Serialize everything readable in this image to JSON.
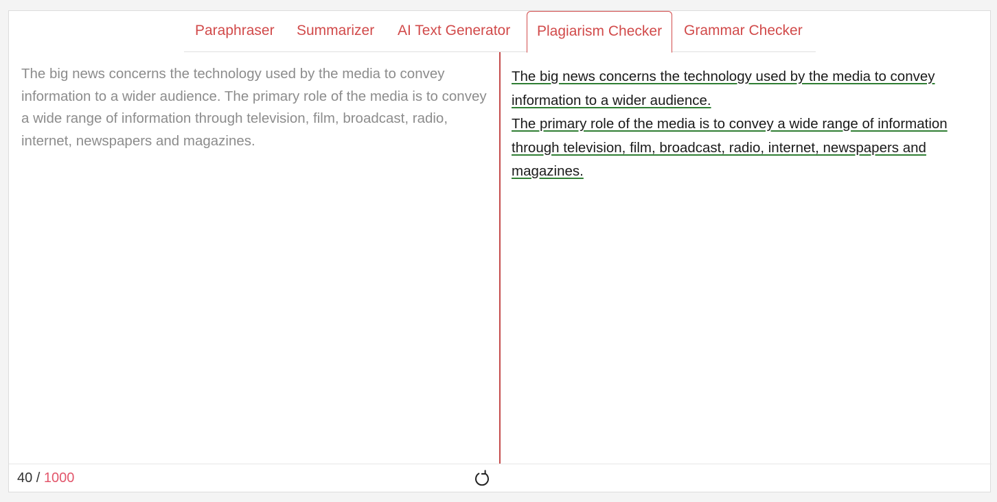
{
  "tabs": [
    {
      "label": "Paraphraser"
    },
    {
      "label": "Summarizer"
    },
    {
      "label": "AI Text Generator"
    },
    {
      "label": "Plagiarism Checker",
      "active": true
    },
    {
      "label": "Grammar Checker"
    }
  ],
  "input": {
    "text": "The big news concerns the technology used by the media to convey information to a wider audience. The primary role of the media is to convey a wide range of information through television, film, broadcast, radio, internet, newspapers and magazines."
  },
  "output": {
    "sentences": [
      "The big news concerns the technology used by the media to convey",
      "information to a wider audience.",
      "The primary role of the media is to convey a wide range of information",
      "through television, film, broadcast, radio, internet, newspapers and",
      "magazines."
    ]
  },
  "footer": {
    "word_count": "40",
    "separator": " / ",
    "word_limit": "1000",
    "refresh_icon": "refresh-icon"
  },
  "colors": {
    "accent": "#d14a4a",
    "limit": "#e2566b",
    "underline": "#2e7d32",
    "input_text": "#8c8c8c"
  }
}
